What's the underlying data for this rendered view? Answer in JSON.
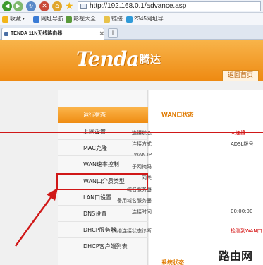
{
  "browser": {
    "back_icon": "back-arrow-icon",
    "forward_icon": "forward-arrow-icon",
    "url": "http://192.168.0.1/advance.asp",
    "favorites_bar": [
      {
        "label": "收藏",
        "icon": "star-folder-icon"
      },
      {
        "label": "网址导航",
        "icon": "site-nav-icon"
      },
      {
        "label": "影视大全",
        "icon": "video-icon"
      },
      {
        "label": "链接",
        "icon": "links-icon"
      },
      {
        "label": "2345网址导",
        "icon": "site-2345-icon"
      }
    ],
    "tab_title": "TENDA 11N无线路由器"
  },
  "router": {
    "logo": "Tenda",
    "logo_cn": "腾达",
    "back_home": "返回首页",
    "menu": [
      {
        "label": "运行状态",
        "active": true
      },
      {
        "label": "上网设置",
        "active": false
      },
      {
        "label": "MAC克隆",
        "active": false
      },
      {
        "label": "WAN速率控制",
        "active": false
      },
      {
        "label": "WAN口介质类型",
        "active": false
      },
      {
        "label": "LAN口设置",
        "active": false
      },
      {
        "label": "DNS设置",
        "active": false
      },
      {
        "label": "DHCP服务器",
        "active": false
      },
      {
        "label": "DHCP客户端列表",
        "active": false
      }
    ],
    "wan_status": {
      "title": "WAN口状态",
      "rows": [
        {
          "label": "连接状态",
          "value": "未连接"
        },
        {
          "label": "连接方式",
          "value": "ADSL拨号"
        },
        {
          "label": "WAN IP",
          "value": ""
        },
        {
          "label": "子网掩码",
          "value": ""
        },
        {
          "label": "网关",
          "value": ""
        },
        {
          "label": "域名服务器",
          "value": ""
        },
        {
          "label": "备用域名服务器",
          "value": ""
        },
        {
          "label": "连接时间",
          "value": "00:00:00"
        },
        {
          "label": "网络连接状态诊断",
          "value": "检测到WAN口"
        }
      ]
    },
    "system_status_title": "系统状态"
  },
  "watermark": "路由网",
  "colors": {
    "brand_orange": "#ef8c12",
    "annotation_red": "#d01818"
  }
}
